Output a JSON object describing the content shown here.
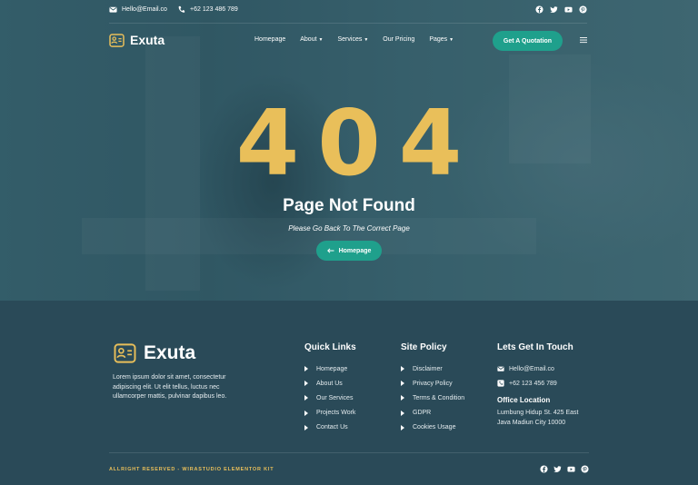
{
  "topbar": {
    "email": "Hello@Email.co",
    "phone": "+62 123 486 789",
    "socials": [
      "facebook-icon",
      "twitter-icon",
      "youtube-icon",
      "pinterest-icon"
    ]
  },
  "brand": {
    "name": "Exuta"
  },
  "nav": {
    "items": [
      {
        "label": "Homepage"
      },
      {
        "label": "About"
      },
      {
        "label": "Services"
      },
      {
        "label": "Our Pricing"
      },
      {
        "label": "Pages"
      }
    ],
    "cta": "Get A Quotation"
  },
  "error": {
    "code": "404",
    "title": "Page Not Found",
    "subtitle": "Please Go Back To The Correct Page",
    "button": "Homepage"
  },
  "footer": {
    "description": "Lorem ipsum dolor sit amet, consectetur adipiscing elit. Ut elit tellus, luctus nec ullamcorper mattis, pulvinar dapibus leo.",
    "quick_links": {
      "title": "Quick Links",
      "items": [
        "Homepage",
        "About Us",
        "Our Services",
        "Projects Work",
        "Contact Us"
      ]
    },
    "site_policy": {
      "title": "Site Policy",
      "items": [
        "Disclaimer",
        "Privacy Policy",
        "Terms & Condition",
        "GDPR",
        "Cookies Usage"
      ]
    },
    "contact": {
      "title": "Lets Get In Touch",
      "email": "Hello@Email.co",
      "phone": "+62 123 456 789",
      "office_title": "Office Location",
      "address_line1": "Lumbung Hidup St. 425 East",
      "address_line2": "Java Madiun City 10000"
    },
    "copyright": "ALLRIGHT RESERVED - WIRASTUDIO ELEMENTOR KIT"
  },
  "colors": {
    "accent": "#1fa08c",
    "gold": "#e9bf5a",
    "footer_bg": "#2a4a58"
  }
}
